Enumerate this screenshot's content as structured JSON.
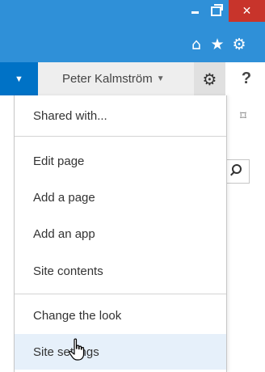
{
  "window": {
    "minimize_glyph": "",
    "close_glyph": "✕"
  },
  "browser": {
    "home_glyph": "⌂",
    "star_glyph": "★",
    "tools_glyph": "⚙"
  },
  "suitebar": {
    "app_caret": "▼",
    "user_name": "Peter Kalmström",
    "user_caret": "▼",
    "settings_glyph": "⚙",
    "help_label": "?"
  },
  "page": {
    "focus_glyph": "⌑"
  },
  "settings_menu": {
    "items": [
      {
        "label": "Shared with..."
      },
      {
        "label": "Edit page"
      },
      {
        "label": "Add a page"
      },
      {
        "label": "Add an app"
      },
      {
        "label": "Site contents"
      },
      {
        "label": "Change the look"
      },
      {
        "label": "Site settings"
      }
    ],
    "hovered_item": "Site settings"
  },
  "colors": {
    "titlebar": "#2f90d8",
    "close_button": "#c8342b",
    "app_dropdown": "#0072c6",
    "hover_row": "#e6f0fa"
  },
  "icons": [
    "minimize-icon",
    "maximize-icon",
    "close-icon",
    "home-icon",
    "favorites-star-icon",
    "tools-gear-icon",
    "settings-gear-icon",
    "help-icon",
    "focus-content-icon",
    "search-icon",
    "hand-pointer-cursor-icon"
  ]
}
